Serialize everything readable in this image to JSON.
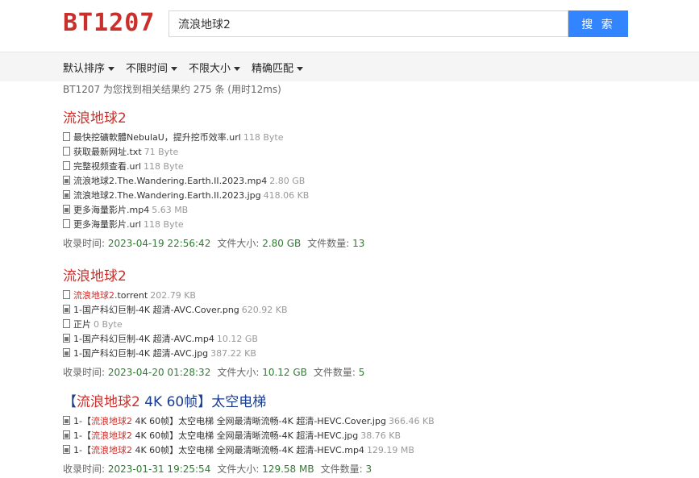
{
  "header": {
    "logo": "BT1207",
    "search_value": "流浪地球2",
    "search_button": "搜 索"
  },
  "filters": [
    "默认排序",
    "不限时间",
    "不限大小",
    "精确匹配"
  ],
  "summary": "BT1207 为您找到相关结果约 275 条 (用时12ms)",
  "results": [
    {
      "title_hl": "流浪地球2",
      "title_rest": "",
      "files": [
        {
          "icon": "file-icon",
          "prefix": "",
          "hl": "",
          "name": "最快挖礦軟體NebulaU，提升挖币效率.url",
          "size": "118 Byte"
        },
        {
          "icon": "file-icon",
          "prefix": "",
          "hl": "",
          "name": "获取最新网址.txt",
          "size": "71 Byte"
        },
        {
          "icon": "file-icon",
          "prefix": "",
          "hl": "",
          "name": "完整视频查看.url",
          "size": "118 Byte"
        },
        {
          "icon": "media-file-icon",
          "prefix": "",
          "hl": "",
          "name": "流浪地球2.The.Wandering.Earth.II.2023.mp4",
          "size": "2.80 GB"
        },
        {
          "icon": "media-file-icon",
          "prefix": "",
          "hl": "",
          "name": "流浪地球2.The.Wandering.Earth.II.2023.jpg",
          "size": "418.06 KB"
        },
        {
          "icon": "media-file-icon",
          "prefix": "",
          "hl": "",
          "name": "更多海量影片.mp4",
          "size": "5.63 MB"
        },
        {
          "icon": "file-icon",
          "prefix": "",
          "hl": "",
          "name": "更多海量影片.url",
          "size": "118 Byte"
        }
      ],
      "time_label": "收录时间:",
      "time": "2023-04-19 22:56:42",
      "size_label": "文件大小:",
      "size": "2.80 GB",
      "count_label": "文件数量:",
      "count": "13"
    },
    {
      "title_hl": "流浪地球2",
      "title_rest": "",
      "files": [
        {
          "icon": "file-icon",
          "prefix": "",
          "hl": "流浪地球2",
          "name": ".torrent",
          "size": "202.79 KB"
        },
        {
          "icon": "media-file-icon",
          "prefix": "",
          "hl": "",
          "name": "1-国产科幻巨制-4K 超清-AVC.Cover.png",
          "size": "620.92 KB"
        },
        {
          "icon": "file-icon",
          "prefix": "",
          "hl": "",
          "name": "正片",
          "size": "0 Byte"
        },
        {
          "icon": "media-file-icon",
          "prefix": "",
          "hl": "",
          "name": "1-国产科幻巨制-4K 超清-AVC.mp4",
          "size": "10.12 GB"
        },
        {
          "icon": "media-file-icon",
          "prefix": "",
          "hl": "",
          "name": "1-国产科幻巨制-4K 超清-AVC.jpg",
          "size": "387.22 KB"
        }
      ],
      "time_label": "收录时间:",
      "time": "2023-04-20 01:28:32",
      "size_label": "文件大小:",
      "size": "10.12 GB",
      "count_label": "文件数量:",
      "count": "5"
    },
    {
      "title_pre": "【",
      "title_hl": "流浪地球2",
      "title_rest": " 4K 60帧】太空电梯",
      "files": [
        {
          "icon": "media-file-icon",
          "prefix": "1-【",
          "hl": "流浪地球2",
          "name": " 4K 60帧】太空电梯 全网最清晰流畅-4K 超清-HEVC.Cover.jpg",
          "size": "366.46 KB"
        },
        {
          "icon": "media-file-icon",
          "prefix": "1-【",
          "hl": "流浪地球2",
          "name": " 4K 60帧】太空电梯 全网最清晰流畅-4K 超清-HEVC.jpg",
          "size": "38.76 KB"
        },
        {
          "icon": "media-file-icon",
          "prefix": "1-【",
          "hl": "流浪地球2",
          "name": " 4K 60帧】太空电梯 全网最清晰流畅-4K 超清-HEVC.mp4",
          "size": "129.19 MB"
        }
      ],
      "time_label": "收录时间:",
      "time": "2023-01-31 19:25:54",
      "size_label": "文件大小:",
      "size": "129.58 MB",
      "count_label": "文件数量:",
      "count": "3"
    }
  ]
}
